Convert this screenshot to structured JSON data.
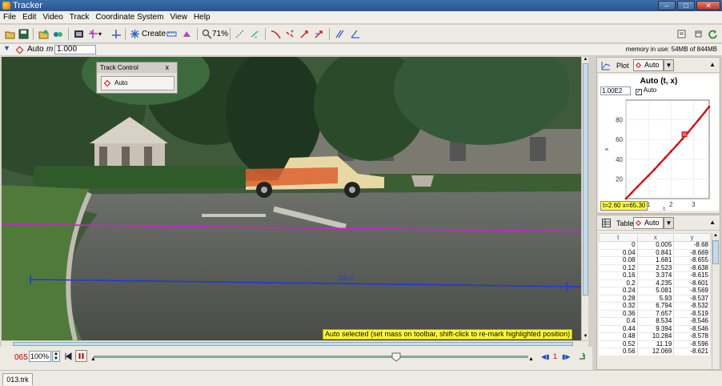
{
  "window": {
    "title": "Tracker"
  },
  "menu": [
    "File",
    "Edit",
    "Video",
    "Track",
    "Coordinate System",
    "View",
    "Help"
  ],
  "toolbar": {
    "create_label": "Create",
    "zoom_label": "71%",
    "memory_label": "memory in use: 54MB of 844MB"
  },
  "trackbar": {
    "track_name": "Auto",
    "mass_label": "m",
    "mass_value": "1.000"
  },
  "track_control": {
    "title": "Track Control",
    "close_glyph": "x",
    "track_button": "Auto"
  },
  "video": {
    "calibration_label": "100.0",
    "status_tip": "Auto selected (set mass on toolbar, shift-click to re-mark highlighted position)"
  },
  "player": {
    "frame": "065",
    "rate": "100%",
    "step_count": "1"
  },
  "plot": {
    "header_label": "Plot",
    "track_label": "Auto",
    "title": "Auto (t, x)",
    "scale_field": "1.00E2",
    "auto_label": "Auto",
    "readout": "t=2.60  x=65.30",
    "chart_data": {
      "type": "line",
      "title": "Auto (t, x)",
      "xlabel": "t",
      "ylabel": "x",
      "xlim": [
        0,
        3.7
      ],
      "ylim": [
        0,
        100
      ],
      "x_ticks": [
        "0",
        "1",
        "2",
        "3"
      ],
      "y_ticks": [
        "20",
        "40",
        "60",
        "80"
      ],
      "series": [
        {
          "name": "Auto",
          "color": "#dd0000",
          "x": [
            0,
            0.25,
            0.5,
            0.75,
            1.0,
            1.25,
            1.5,
            1.75,
            2.0,
            2.25,
            2.5,
            2.75,
            3.0,
            3.25,
            3.5,
            3.7
          ],
          "y": [
            0.0,
            5.8,
            11.8,
            17.6,
            23.3,
            29.2,
            35.5,
            41.6,
            47.9,
            54.0,
            60.4,
            66.8,
            73.7,
            80.6,
            87.6,
            93.3
          ]
        }
      ],
      "highlight": {
        "t": 2.6,
        "x": 65.3
      }
    }
  },
  "table": {
    "header_label": "Table",
    "track_label": "Auto",
    "columns": [
      "t",
      "x",
      "y"
    ],
    "rows": [
      [
        "0",
        "0.005",
        "-8.68"
      ],
      [
        "0.04",
        "0.841",
        "-8.669"
      ],
      [
        "0.08",
        "1.681",
        "-8.655"
      ],
      [
        "0.12",
        "2.523",
        "-8.638"
      ],
      [
        "0.16",
        "3.374",
        "-8.615"
      ],
      [
        "0.2",
        "4.235",
        "-8.601"
      ],
      [
        "0.24",
        "5.081",
        "-8.569"
      ],
      [
        "0.28",
        "5.93",
        "-8.537"
      ],
      [
        "0.32",
        "6.794",
        "-8.532"
      ],
      [
        "0.36",
        "7.657",
        "-8.519"
      ],
      [
        "0.4",
        "8.534",
        "-8.546"
      ],
      [
        "0.44",
        "9.394",
        "-8.546"
      ],
      [
        "0.48",
        "10.284",
        "-8.578"
      ],
      [
        "0.52",
        "11.19",
        "-8.596"
      ],
      [
        "0.56",
        "12.069",
        "-8.621"
      ]
    ]
  },
  "tabs": {
    "file_tab": "013.trk"
  }
}
